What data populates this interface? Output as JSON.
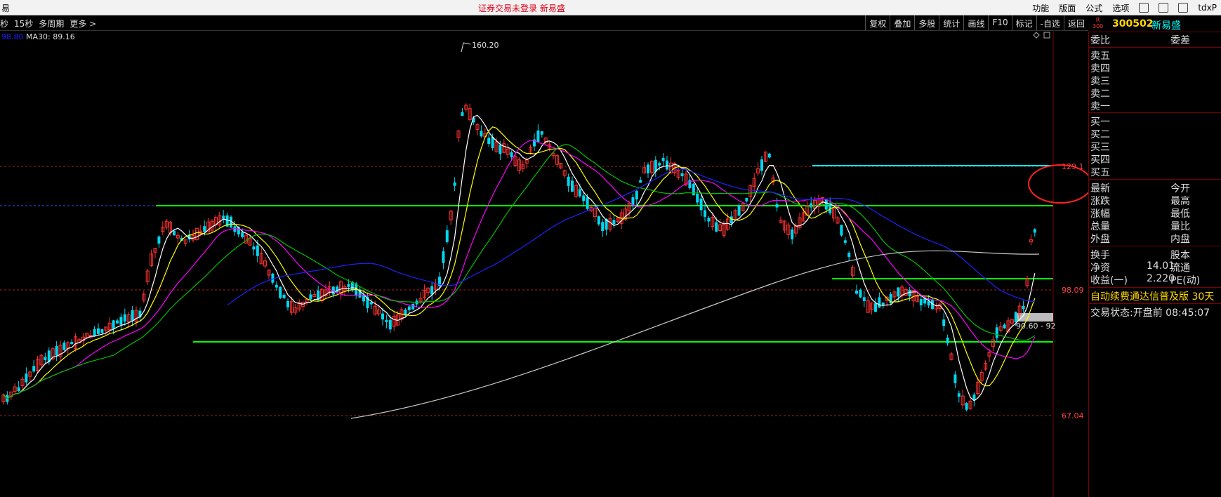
{
  "topbar": {
    "lead": "易",
    "center": "证券交易未登录  新易盛",
    "menu": [
      "功能",
      "版面",
      "公式",
      "选项"
    ],
    "tail": "tdxP"
  },
  "toolbar": {
    "left": [
      "秒",
      "15秒",
      "多周期",
      "更多 >"
    ],
    "right": [
      "复权",
      "叠加",
      "多股",
      "统计",
      "画线",
      "F10",
      "标记",
      "-自选",
      "返回"
    ]
  },
  "legend": {
    "ma20_value": "98.80",
    "ma30_text": "MA30: 89.16"
  },
  "chart_data": {
    "type": "candlestick",
    "symbol": "300502",
    "name": "新易盛",
    "price_labels": {
      "high": "160.20",
      "upper": "129.1",
      "mid": "98.09",
      "low": "67.04",
      "note": "90.60 - 92"
    },
    "colors": {
      "up": "#ff3232",
      "down": "#00d8f0",
      "ma5": "#ffffff",
      "ma10": "#ffff00",
      "ma20": "#ff00ff",
      "ma30": "#00c000",
      "ma60": "#2020ff",
      "ma250": "#c8c8c8",
      "hline_green": "#00ff00",
      "hline_cyan": "#00ffff"
    }
  },
  "stock": {
    "badge_top": "R",
    "badge_bottom": "300",
    "code": "300502",
    "name": "新易盛"
  },
  "quote": {
    "header_left": "委比",
    "header_right": "委差",
    "sells": [
      "卖五",
      "卖四",
      "卖三",
      "卖二",
      "卖一"
    ],
    "buys": [
      "买一",
      "买二",
      "买三",
      "买四",
      "买五"
    ],
    "stats": [
      {
        "a": "最新",
        "b": "今开"
      },
      {
        "a": "涨跌",
        "b": "最高"
      },
      {
        "a": "涨幅",
        "b": "最低"
      },
      {
        "a": "总量",
        "b": "量比"
      },
      {
        "a": "外盘",
        "b": "内盘"
      }
    ],
    "fund": [
      {
        "a": "换手",
        "v": "",
        "b": "股本"
      },
      {
        "a": "净资",
        "v": "14.01",
        "b": "流通"
      },
      {
        "a": "收益(一)",
        "v": "2.220",
        "b": "PE(动)"
      }
    ],
    "ticker": "自动续费通达信普及版  30天",
    "status_label": "交易状态:",
    "status_value": "开盘前",
    "status_time": "08:45:07"
  }
}
